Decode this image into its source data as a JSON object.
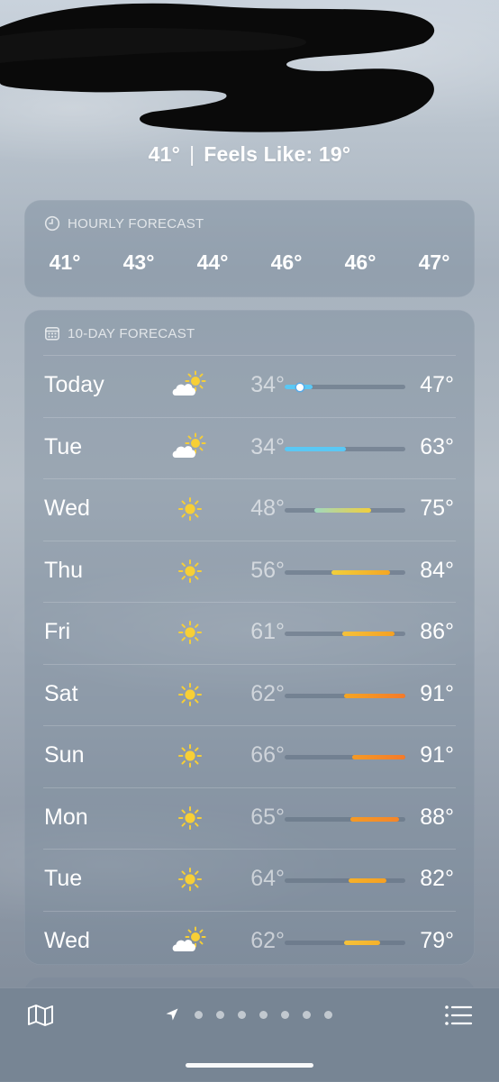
{
  "current": {
    "temp": "41°",
    "separator": "|",
    "feels_like": "Feels Like: 19°"
  },
  "hourly": {
    "title": "HOURLY FORECAST",
    "icon": "clock-icon",
    "temps": [
      "41°",
      "43°",
      "44°",
      "46°",
      "46°",
      "47°"
    ]
  },
  "daily": {
    "title": "10-DAY FORECAST",
    "icon": "calendar-icon",
    "range_min_f": 34,
    "range_max_f": 91,
    "days": [
      {
        "day": "Today",
        "icon": "partly-sunny-icon",
        "low": "34°",
        "high": "47°",
        "low_val": 34,
        "high_val": 47,
        "current_val": 41,
        "bar_colors": [
          "#5ac8f5",
          "#5ac8f5"
        ]
      },
      {
        "day": "Tue",
        "icon": "partly-sunny-icon",
        "low": "34°",
        "high": "63°",
        "low_val": 34,
        "high_val": 63,
        "bar_colors": [
          "#5ac8f5",
          "#5ac8f5"
        ]
      },
      {
        "day": "Wed",
        "icon": "sun-icon",
        "low": "48°",
        "high": "75°",
        "low_val": 48,
        "high_val": 75,
        "bar_colors": [
          "#9fd8c0",
          "#f2cf3b"
        ]
      },
      {
        "day": "Thu",
        "icon": "sun-icon",
        "low": "56°",
        "high": "84°",
        "low_val": 56,
        "high_val": 84,
        "bar_colors": [
          "#f2cf3b",
          "#f5a623"
        ]
      },
      {
        "day": "Fri",
        "icon": "sun-icon",
        "low": "61°",
        "high": "86°",
        "low_val": 61,
        "high_val": 86,
        "bar_colors": [
          "#f5c23b",
          "#f5a023"
        ]
      },
      {
        "day": "Sat",
        "icon": "sun-icon",
        "low": "62°",
        "high": "91°",
        "low_val": 62,
        "high_val": 91,
        "bar_colors": [
          "#f5a623",
          "#f47a2a"
        ]
      },
      {
        "day": "Sun",
        "icon": "sun-icon",
        "low": "66°",
        "high": "91°",
        "low_val": 66,
        "high_val": 91,
        "bar_colors": [
          "#f59a25",
          "#f47a2a"
        ]
      },
      {
        "day": "Mon",
        "icon": "sun-icon",
        "low": "65°",
        "high": "88°",
        "low_val": 65,
        "high_val": 88,
        "bar_colors": [
          "#f59a25",
          "#f5862a"
        ]
      },
      {
        "day": "Tue",
        "icon": "sun-icon",
        "low": "64°",
        "high": "82°",
        "low_val": 64,
        "high_val": 82,
        "bar_colors": [
          "#f5b12a",
          "#f5a023"
        ]
      },
      {
        "day": "Wed",
        "icon": "partly-sunny-icon",
        "low": "62°",
        "high": "79°",
        "low_val": 62,
        "high_val": 79,
        "bar_colors": [
          "#f5c23b",
          "#f5b12a"
        ]
      }
    ]
  },
  "bottom_bar": {
    "map_icon": "map-icon",
    "location_icon": "location-arrow-icon",
    "page_dots": 7,
    "list_icon": "list-icon"
  },
  "colors": {
    "sun": "#f7cf36",
    "cloud": "#ffffff",
    "current_dot_ring": "#5aaae6"
  }
}
